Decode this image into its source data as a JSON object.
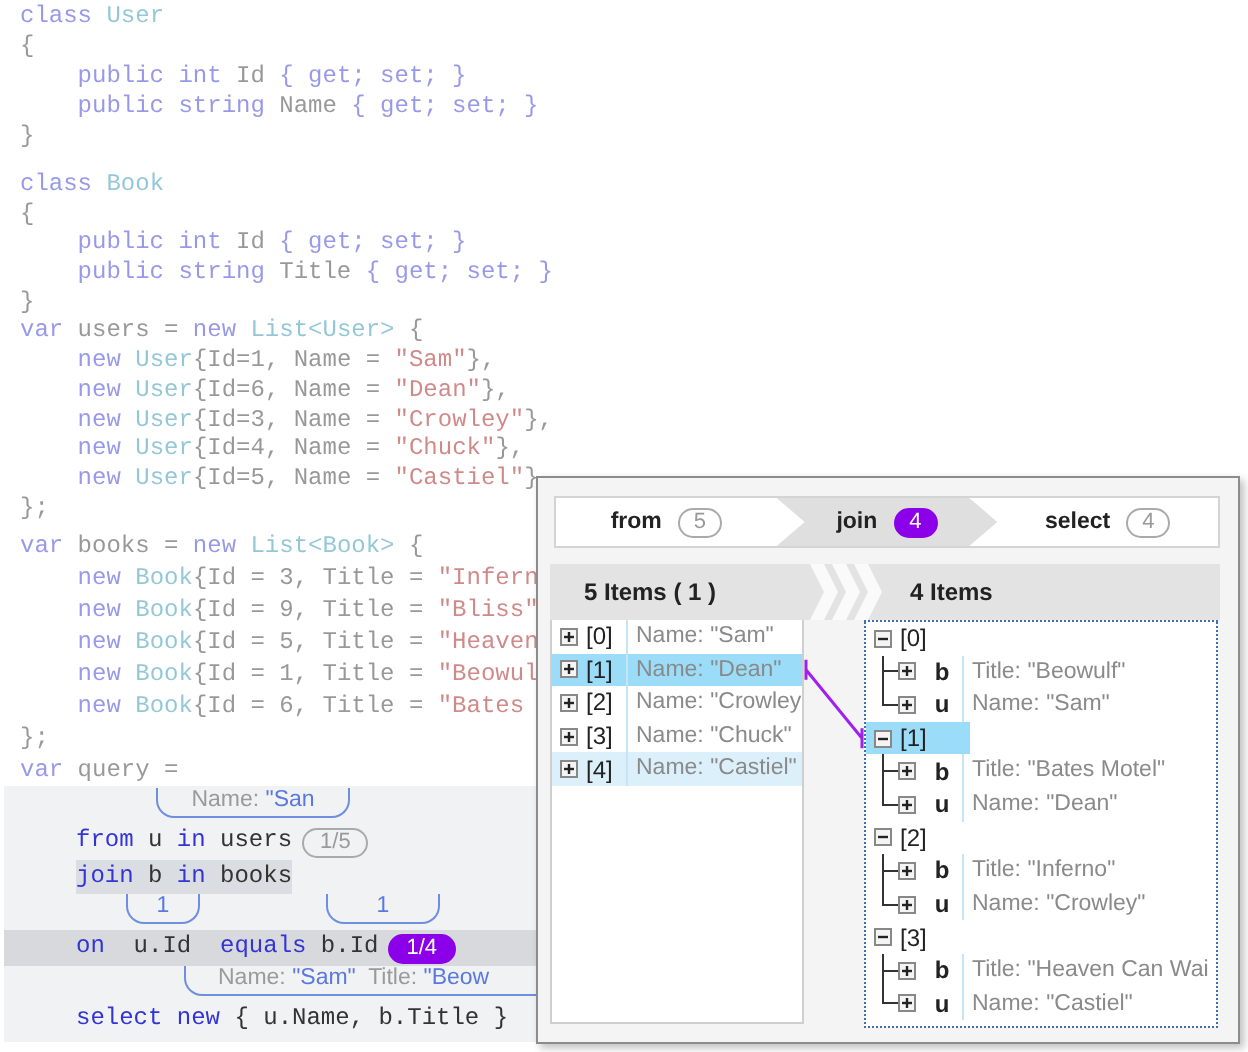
{
  "code_blocks": [
    {
      "dimmed": true,
      "lines": [
        [
          {
            "kind": "keyword",
            "text": "class"
          },
          {
            "kind": "type",
            "text": " User"
          }
        ],
        [
          {
            "kind": "plain",
            "text": "{"
          }
        ],
        [
          {
            "kind": "keyword",
            "text": "    public int"
          },
          {
            "kind": "plain",
            "text": " Id "
          },
          {
            "kind": "keyword",
            "text": "{ get; set; }"
          }
        ],
        [
          {
            "kind": "keyword",
            "text": "    public string"
          },
          {
            "kind": "plain",
            "text": " Name "
          },
          {
            "kind": "keyword",
            "text": "{ get; set; }"
          }
        ],
        [
          {
            "kind": "plain",
            "text": "}"
          }
        ]
      ]
    },
    {
      "dimmed": true,
      "lines": [
        [
          {
            "kind": "keyword",
            "text": "class"
          },
          {
            "kind": "type",
            "text": " Book"
          }
        ],
        [
          {
            "kind": "plain",
            "text": "{"
          }
        ],
        [
          {
            "kind": "keyword",
            "text": "    public int"
          },
          {
            "kind": "plain",
            "text": " Id "
          },
          {
            "kind": "keyword",
            "text": "{ get; set; }"
          }
        ],
        [
          {
            "kind": "keyword",
            "text": "    public string"
          },
          {
            "kind": "plain",
            "text": " Title "
          },
          {
            "kind": "keyword",
            "text": "{ get; set; }"
          }
        ],
        [
          {
            "kind": "plain",
            "text": "}"
          }
        ],
        [
          {
            "kind": "keyword",
            "text": "var"
          },
          {
            "kind": "plain",
            "text": " users = "
          },
          {
            "kind": "keyword",
            "text": "new"
          },
          {
            "kind": "type",
            "text": " List<User>"
          },
          {
            "kind": "plain",
            "text": " {"
          }
        ],
        [
          {
            "kind": "keyword",
            "text": "    new"
          },
          {
            "kind": "type",
            "text": " User"
          },
          {
            "kind": "plain",
            "text": "{Id=1, Name = "
          },
          {
            "kind": "string",
            "text": "\"Sam\""
          },
          {
            "kind": "plain",
            "text": "},"
          }
        ],
        [
          {
            "kind": "keyword",
            "text": "    new"
          },
          {
            "kind": "type",
            "text": " User"
          },
          {
            "kind": "plain",
            "text": "{Id=6, Name = "
          },
          {
            "kind": "string",
            "text": "\"Dean\""
          },
          {
            "kind": "plain",
            "text": "},"
          }
        ],
        [
          {
            "kind": "keyword",
            "text": "    new"
          },
          {
            "kind": "type",
            "text": " User"
          },
          {
            "kind": "plain",
            "text": "{Id=3, Name = "
          },
          {
            "kind": "string",
            "text": "\"Crowley\""
          },
          {
            "kind": "plain",
            "text": "},"
          }
        ],
        [
          {
            "kind": "keyword",
            "text": "    new"
          },
          {
            "kind": "type",
            "text": " User"
          },
          {
            "kind": "plain",
            "text": "{Id=4, Name = "
          },
          {
            "kind": "string",
            "text": "\"Chuck\""
          },
          {
            "kind": "plain",
            "text": "},"
          }
        ],
        [
          {
            "kind": "keyword",
            "text": "    new"
          },
          {
            "kind": "type",
            "text": " User"
          },
          {
            "kind": "plain",
            "text": "{Id=5, Name = "
          },
          {
            "kind": "string",
            "text": "\"Castiel\""
          },
          {
            "kind": "plain",
            "text": "}"
          }
        ],
        [
          {
            "kind": "plain",
            "text": "};"
          }
        ]
      ]
    },
    {
      "dimmed": true,
      "lines": [
        [
          {
            "kind": "keyword",
            "text": "var"
          },
          {
            "kind": "plain",
            "text": " books = "
          },
          {
            "kind": "keyword",
            "text": "new"
          },
          {
            "kind": "type",
            "text": " List<Book>"
          },
          {
            "kind": "plain",
            "text": " {"
          }
        ],
        [
          {
            "kind": "keyword",
            "text": "    new"
          },
          {
            "kind": "type",
            "text": " Book"
          },
          {
            "kind": "plain",
            "text": "{Id = 3, Title = "
          },
          {
            "kind": "string",
            "text": "\"Infern"
          }
        ],
        [
          {
            "kind": "keyword",
            "text": "    new"
          },
          {
            "kind": "type",
            "text": " Book"
          },
          {
            "kind": "plain",
            "text": "{Id = 9, Title = "
          },
          {
            "kind": "string",
            "text": "\"Bliss\""
          }
        ],
        [
          {
            "kind": "keyword",
            "text": "    new"
          },
          {
            "kind": "type",
            "text": " Book"
          },
          {
            "kind": "plain",
            "text": "{Id = 5, Title = "
          },
          {
            "kind": "string",
            "text": "\"Heaven"
          }
        ],
        [
          {
            "kind": "keyword",
            "text": "    new"
          },
          {
            "kind": "type",
            "text": " Book"
          },
          {
            "kind": "plain",
            "text": "{Id = 1, Title = "
          },
          {
            "kind": "string",
            "text": "\"Beowul"
          }
        ],
        [
          {
            "kind": "keyword",
            "text": "    new"
          },
          {
            "kind": "type",
            "text": " Book"
          },
          {
            "kind": "plain",
            "text": "{Id = 6, Title = "
          },
          {
            "kind": "string",
            "text": "\"Bates"
          }
        ],
        [
          {
            "kind": "plain",
            "text": "};"
          }
        ],
        [
          {
            "kind": "keyword",
            "text": "var"
          },
          {
            "kind": "plain",
            "text": " query ="
          }
        ]
      ]
    }
  ],
  "query": {
    "lines": [
      {
        "kind": "hints",
        "hints": [
          [
            {
              "kind": "label",
              "text": "Name: "
            },
            {
              "kind": "value",
              "text": "\"San"
            }
          ]
        ]
      },
      {
        "kind": "code",
        "line_highlighted": false,
        "phrase_highlighted": false,
        "tokens": [
          {
            "kind": "keyword",
            "text": "from"
          },
          {
            "kind": "plain",
            "text": " u "
          },
          {
            "kind": "keyword",
            "text": "in"
          },
          {
            "kind": "plain",
            "text": " users"
          }
        ],
        "count": {
          "text": "1/5",
          "active": false
        }
      },
      {
        "kind": "code",
        "line_highlighted": false,
        "phrase_highlighted": true,
        "tokens": [
          {
            "kind": "keyword",
            "text": "join"
          },
          {
            "kind": "plain",
            "text": " b "
          },
          {
            "kind": "keyword",
            "text": "in"
          },
          {
            "kind": "plain",
            "text": " books"
          }
        ]
      },
      {
        "kind": "hints",
        "hints": [
          [
            {
              "kind": "value",
              "text": "1"
            }
          ],
          [
            {
              "kind": "value",
              "text": "1"
            }
          ]
        ]
      },
      {
        "kind": "code",
        "line_highlighted": true,
        "phrase_highlighted": false,
        "tokens": [
          {
            "kind": "keyword",
            "text": "on"
          },
          {
            "kind": "plain",
            "text": "  u.Id  "
          },
          {
            "kind": "keyword",
            "text": "equals"
          },
          {
            "kind": "plain",
            "text": " b.Id"
          }
        ],
        "count": {
          "text": "1/4",
          "active": true
        }
      },
      {
        "kind": "hints",
        "hints": [
          [
            {
              "kind": "label",
              "text": "Name: "
            },
            {
              "kind": "value",
              "text": "\"Sam\""
            },
            {
              "kind": "label",
              "text": "  Title: "
            },
            {
              "kind": "value",
              "text": "\"Beow"
            }
          ]
        ]
      },
      {
        "kind": "code",
        "line_highlighted": false,
        "phrase_highlighted": false,
        "tokens": [
          {
            "kind": "keyword",
            "text": "select new"
          },
          {
            "kind": "plain",
            "text": " { u.Name, b.Title }"
          }
        ]
      }
    ]
  },
  "popup": {
    "stages": [
      {
        "label": "from",
        "count": "5",
        "selected": false
      },
      {
        "label": "join",
        "count": "4",
        "selected": true
      },
      {
        "label": "select",
        "count": "4",
        "selected": false
      }
    ],
    "source": {
      "header": "5 Items ( 1 )",
      "rows": [
        {
          "index": "[0]",
          "value": "Name: \"Sam\"",
          "expanded": false,
          "selected": false,
          "related": false
        },
        {
          "index": "[1]",
          "value": "Name: \"Dean\"",
          "expanded": false,
          "selected": true,
          "related": false
        },
        {
          "index": "[2]",
          "value": "Name: \"Crowley",
          "expanded": false,
          "selected": false,
          "related": false
        },
        {
          "index": "[3]",
          "value": "Name: \"Chuck\"",
          "expanded": false,
          "selected": false,
          "related": false
        },
        {
          "index": "[4]",
          "value": "Name: \"Castiel\"",
          "expanded": false,
          "selected": false,
          "related": true
        }
      ]
    },
    "result": {
      "header": "4 Items",
      "nodes": [
        {
          "index": "[0]",
          "expanded": true,
          "selected": false,
          "children": [
            {
              "name": "b",
              "value": "Title: \"Beowulf\"",
              "expanded": false
            },
            {
              "name": "u",
              "value": "Name: \"Sam\"",
              "expanded": false
            }
          ]
        },
        {
          "index": "[1]",
          "expanded": true,
          "selected": true,
          "children": [
            {
              "name": "b",
              "value": "Title: \"Bates Motel\"",
              "expanded": false
            },
            {
              "name": "u",
              "value": "Name: \"Dean\"",
              "expanded": false
            }
          ]
        },
        {
          "index": "[2]",
          "expanded": true,
          "selected": false,
          "children": [
            {
              "name": "b",
              "value": "Title: \"Inferno\"",
              "expanded": false
            },
            {
              "name": "u",
              "value": "Name: \"Crowley\"",
              "expanded": false
            }
          ]
        },
        {
          "index": "[3]",
          "expanded": true,
          "selected": false,
          "children": [
            {
              "name": "b",
              "value": "Title: \"Heaven Can Wai",
              "expanded": false
            },
            {
              "name": "u",
              "value": "Name: \"Castiel\"",
              "expanded": false
            }
          ]
        }
      ]
    }
  }
}
